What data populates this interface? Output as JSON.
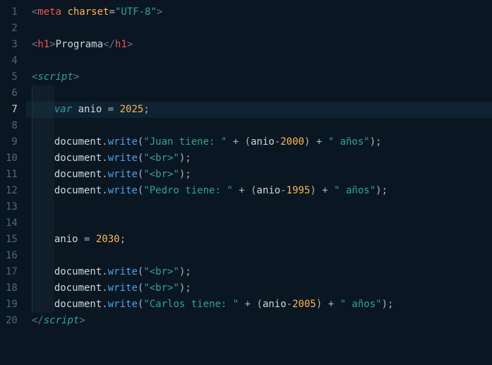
{
  "lineNumbers": [
    "1",
    "2",
    "3",
    "4",
    "5",
    "6",
    "7",
    "8",
    "9",
    "10",
    "11",
    "12",
    "13",
    "14",
    "15",
    "16",
    "17",
    "18",
    "19",
    "20"
  ],
  "activeLine": 7,
  "tokens": {
    "meta_open": "meta",
    "meta_attr": "charset",
    "meta_val": "\"UTF-8\"",
    "h1_open": "h1",
    "h1_text": "Programa",
    "h1_close": "h1",
    "script_open": "script",
    "script_close": "script",
    "var_kw": "var",
    "anio": "anio",
    "eq": "=",
    "n2025": "2025",
    "n2030": "2030",
    "n2000": "2000",
    "n1995": "1995",
    "n2005": "2005",
    "semicolon": ";",
    "doc": "document",
    "dot": ".",
    "write": "write",
    "lp": "(",
    "rp": ")",
    "plus": "+",
    "minus": "-",
    "s_juan": "\"Juan tiene: \"",
    "s_pedro": "\"Pedro tiene: \"",
    "s_carlos": "\"Carlos tiene: \"",
    "s_anios": "\" años\"",
    "s_br": "\"<br>\"",
    "lt": "<",
    "gt": ">",
    "slashgt": "/"
  },
  "chart_data": null
}
